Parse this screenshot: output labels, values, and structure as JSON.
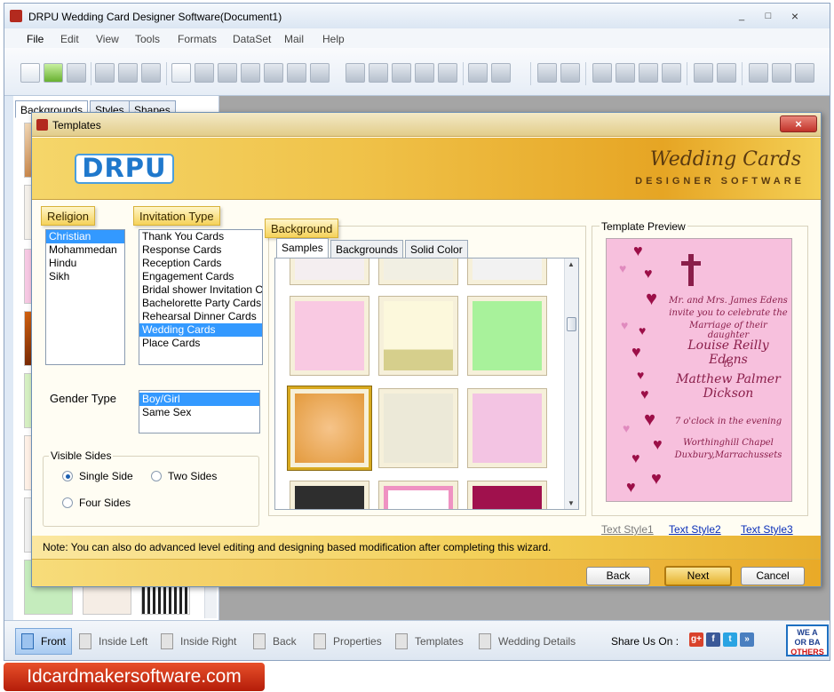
{
  "app": {
    "title": "DRPU Wedding Card Designer Software(Document1)",
    "window_controls": [
      "_",
      "□",
      "×"
    ]
  },
  "menu": [
    "File",
    "Edit",
    "View",
    "Tools",
    "Formats",
    "DataSet",
    "Mail",
    "Help"
  ],
  "left_panel": {
    "tabs": [
      "Backgrounds",
      "Styles",
      "Shapes"
    ]
  },
  "dialog": {
    "title": "Templates",
    "close_label": "×",
    "banner": {
      "logo": "DRPU",
      "product_title": "Wedding Cards",
      "product_subtitle": "DESIGNER SOFTWARE"
    },
    "religion": {
      "label": "Religion",
      "items": [
        "Christian",
        "Mohammedan",
        "Hindu",
        "Sikh"
      ],
      "selected": "Christian"
    },
    "invitation_type": {
      "label": "Invitation Type",
      "items": [
        "Thank You Cards",
        "Response Cards",
        "Reception Cards",
        "Engagement Cards",
        "Bridal shower Invitation C",
        "Bachelorette Party Cards",
        "Rehearsal Dinner Cards",
        "Wedding Cards",
        "Place Cards"
      ],
      "selected": "Wedding Cards"
    },
    "gender_type": {
      "label": "Gender Type",
      "items": [
        "Boy/Girl",
        "Same Sex"
      ],
      "selected": "Boy/Girl"
    },
    "visible_sides": {
      "label": "Visible Sides",
      "options": [
        "Single Side",
        "Two Sides",
        "Four Sides"
      ],
      "selected": "Single Side"
    },
    "background": {
      "label": "Background",
      "tabs": [
        "Samples",
        "Backgrounds",
        "Solid Color"
      ],
      "active_tab": "Samples"
    },
    "preview": {
      "label": "Template Preview",
      "card_lines": [
        "Mr. and Mrs. James Edens",
        "invite you to celebrate the",
        "Marriage of their daughter",
        "Louise Reilly Edens",
        "to",
        "Matthew Palmer Dickson",
        "7 o'clock in the evening",
        "Worthinghill Chapel",
        "Duxbury,Marrachussets"
      ],
      "text_styles": [
        "Text Style1",
        "Text Style2",
        "Text Style3"
      ]
    },
    "note": "Note: You can also do advanced level editing and designing based modification after completing this wizard.",
    "buttons": {
      "back": "Back",
      "next": "Next",
      "cancel": "Cancel"
    }
  },
  "bottom_bar": {
    "items": [
      "Front",
      "Inside Left",
      "Inside Right",
      "Back",
      "Properties",
      "Templates",
      "Wedding Details"
    ],
    "active": "Front",
    "share_label": "Share Us On :",
    "social": [
      {
        "name": "google-plus",
        "glyph": "g+",
        "color": "#d9422b"
      },
      {
        "name": "facebook",
        "glyph": "f",
        "color": "#3b5998"
      },
      {
        "name": "twitter",
        "glyph": "t",
        "color": "#2aa4e3"
      },
      {
        "name": "share",
        "glyph": "»",
        "color": "#4a7fc0"
      }
    ],
    "badge_lines": [
      "WE A",
      "OR BA",
      "OTHERS"
    ]
  },
  "website": "Idcardmakersoftware.com",
  "colors": {
    "accent_gold": "#f0c34a",
    "selection_blue": "#3399ff",
    "card_pink": "#f7c0dd",
    "heart_red": "#9c0f48"
  }
}
